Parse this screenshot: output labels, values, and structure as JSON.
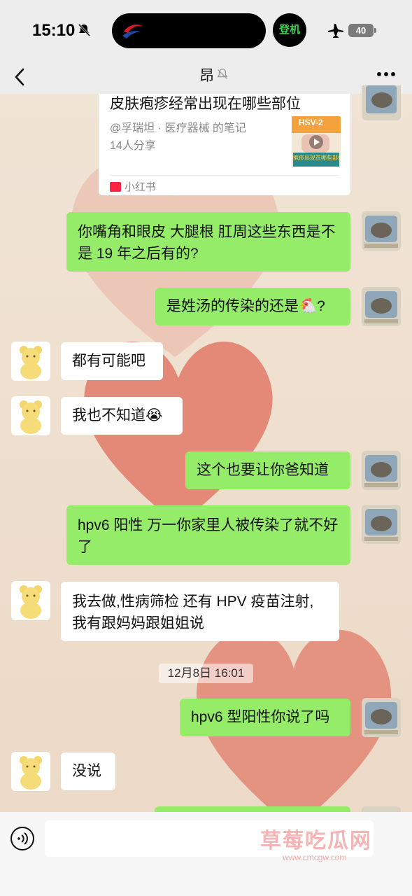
{
  "status_bar": {
    "time": "15:10",
    "boarding_label": "登机",
    "battery": "40"
  },
  "header": {
    "title": "昂"
  },
  "shared_card": {
    "title": "皮肤疱疹经常出现在哪些部位",
    "author": "@孚瑞坦 · 医疗器械 的笔记",
    "shares": "14人分享",
    "source": "小红书",
    "thumb_text_top": "HSV-2",
    "thumb_text_bottom": "疱疹出现在哪些部位"
  },
  "messages": [
    {
      "side": "out",
      "text": "你嘴角和眼皮 大腿根 肛周这些东西是不是 19 年之后有的?"
    },
    {
      "side": "out",
      "text": "是姓汤的传染的还是🐔?"
    },
    {
      "side": "in",
      "text": "都有可能吧"
    },
    {
      "side": "in",
      "text": "我也不知道😭"
    },
    {
      "side": "out",
      "text": "这个也要让你爸知道"
    },
    {
      "side": "out",
      "text": "hpv6 阳性 万一你家里人被传染了就不好了"
    },
    {
      "side": "in",
      "text": "我去做,性病筛检 还有 HPV 疫苗注射, 我有跟妈妈跟姐姐说"
    },
    {
      "side": "out",
      "text": "hpv6 型阳性你说了吗"
    },
    {
      "side": "in",
      "text": "没说"
    }
  ],
  "timestamp": "12月8日 16:01",
  "input": {
    "placeholder": ""
  },
  "watermark": {
    "text": "草莓吃瓜网",
    "url": "www.cmcgw.com"
  },
  "colors": {
    "outgoing_bubble": "#95ec69",
    "incoming_bubble": "#ffffff",
    "bar_background": "#ededed"
  }
}
